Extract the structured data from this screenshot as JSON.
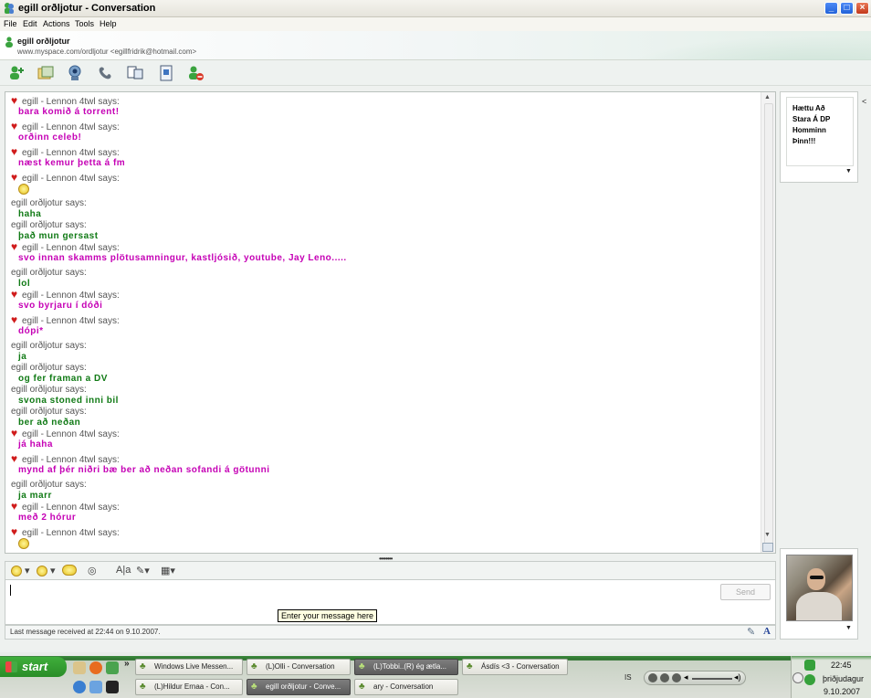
{
  "window": {
    "title": "egill orðljotur - Conversation",
    "min_label": "_",
    "max_label": "□",
    "close_label": "×"
  },
  "menu": {
    "items": [
      "File",
      "Edit",
      "Actions",
      "Tools",
      "Help"
    ]
  },
  "contact": {
    "name": "egill orðljotur",
    "personal_message": "www.myspace.com/ordljotur <egillfridrik@hotmail.com>"
  },
  "toolbar": {
    "icons": [
      "invite-contact-icon",
      "send-files-icon",
      "webcam-icon",
      "call-icon",
      "activities-icon",
      "games-icon",
      "block-icon"
    ]
  },
  "conversation": {
    "messages": [
      {
        "sender": "egill - Lennon 4twl says:",
        "heart": true,
        "text": "bara komið á torrent!",
        "color": "pink"
      },
      {
        "sender": "egill - Lennon 4twl says:",
        "heart": true,
        "text": "orðinn celeb!",
        "color": "pink"
      },
      {
        "sender": "egill - Lennon 4twl says:",
        "heart": true,
        "text": "næst kemur þetta á fm",
        "color": "pink"
      },
      {
        "sender": "egill - Lennon 4twl says:",
        "heart": true,
        "text": "",
        "emoticon": true,
        "color": "pink"
      },
      {
        "sender": "egill orðljotur says:",
        "heart": false,
        "text": "haha",
        "color": "green"
      },
      {
        "sender": "egill orðljotur says:",
        "heart": false,
        "text": "það mun gersast",
        "color": "green"
      },
      {
        "sender": "egill - Lennon 4twl says:",
        "heart": true,
        "text": "svo innan skamms plötusamningur, kastljósið, youtube, Jay Leno.....",
        "color": "pink"
      },
      {
        "sender": "egill orðljotur says:",
        "heart": false,
        "text": "lol",
        "color": "green"
      },
      {
        "sender": "egill - Lennon 4twl says:",
        "heart": true,
        "text": "svo byrjaru í dóði",
        "color": "pink"
      },
      {
        "sender": "egill - Lennon 4twl says:",
        "heart": true,
        "text": "dópi*",
        "color": "pink"
      },
      {
        "sender": "egill orðljotur says:",
        "heart": false,
        "text": "ja",
        "color": "green"
      },
      {
        "sender": "egill orðljotur says:",
        "heart": false,
        "text": "og fer framan a DV",
        "color": "green"
      },
      {
        "sender": "egill orðljotur says:",
        "heart": false,
        "text": "svona stoned inni bil",
        "color": "green"
      },
      {
        "sender": "egill orðljotur says:",
        "heart": false,
        "text": "ber að neðan",
        "color": "green"
      },
      {
        "sender": "egill - Lennon 4twl says:",
        "heart": true,
        "text": "já haha",
        "color": "pink"
      },
      {
        "sender": "egill - Lennon 4twl says:",
        "heart": true,
        "text": "mynd af þér niðri bæ ber að neðan sofandi á götunni",
        "color": "pink"
      },
      {
        "sender": "egill orðljotur says:",
        "heart": false,
        "text": "ja marr",
        "color": "green"
      },
      {
        "sender": "egill - Lennon 4twl says:",
        "heart": true,
        "text": "með 2 hórur",
        "color": "pink"
      },
      {
        "sender": "egill - Lennon 4twl says:",
        "heart": true,
        "text": "",
        "emoticon": true,
        "color": "pink"
      }
    ]
  },
  "compose": {
    "send_label": "Send",
    "tooltip": "Enter your message here",
    "status": "Last message received at 22:44 on 9.10.2007."
  },
  "right_panel": {
    "note_lines": [
      "Hættu Að",
      "Stara Á DP",
      "Homminn",
      "Þinn!!!"
    ]
  },
  "taskbar": {
    "start_label": "start",
    "chevron": "»",
    "tasks_row1": [
      {
        "label": "Windows Live Messen...",
        "active": false
      },
      {
        "label": "(L)Olli - Conversation",
        "active": false
      },
      {
        "label": "(L)Tobbi..(R) ég ætla...",
        "active": true
      },
      {
        "label": "Ásdís <3 - Conversation",
        "active": false
      }
    ],
    "tasks_row2": [
      {
        "label": "(L)Hildur Ernaa - Con...",
        "active": false
      },
      {
        "label": "egill orðljotur - Conve...",
        "active": true
      },
      {
        "label": "ary - Conversation",
        "active": false
      }
    ],
    "language": "IS",
    "time": "22:45",
    "day": "þriðjudagur",
    "date": "9.10.2007"
  },
  "colors": {
    "pink_text": "#c500b5",
    "green_text": "#107a15",
    "heart": "#d01c1c",
    "taskbar_green": "#2b6e2c"
  }
}
